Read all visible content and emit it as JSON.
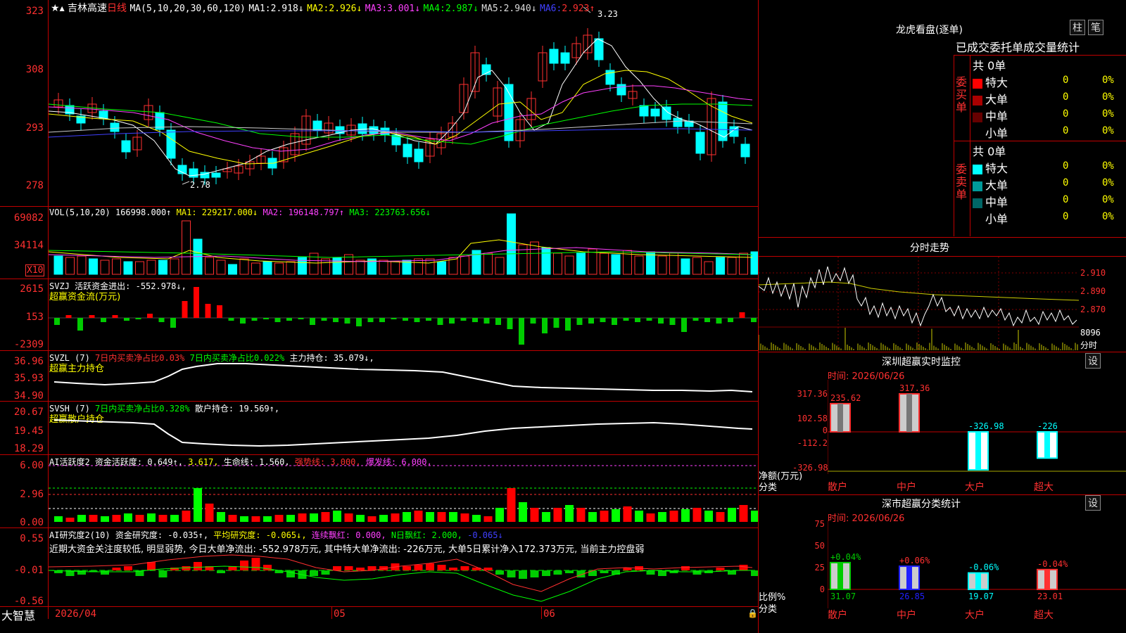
{
  "main": {
    "stock_name": "吉林高速",
    "period": "日线",
    "ma_title": "MA(5,10,20,30,60,120)",
    "ma": [
      {
        "label": "MA1:",
        "value": "2.918↓",
        "color": "#ffffff"
      },
      {
        "label": "MA2:",
        "value": "2.926↓",
        "color": "#ffff00"
      },
      {
        "label": "MA3:",
        "value": "3.001↓",
        "color": "#ff40ff"
      },
      {
        "label": "MA4:",
        "value": "2.987↓",
        "color": "#00ff00"
      },
      {
        "label": "MA5:",
        "value": "2.940↓",
        "color": "#dddddd"
      },
      {
        "label": "MA6:",
        "value": "2.923↑",
        "color": "#4040ff"
      }
    ],
    "yaxis": [
      "323",
      "308",
      "293",
      "278"
    ],
    "high_label": "3.23",
    "low_label": "2.78"
  },
  "vol": {
    "title": "VOL(5,10,20)",
    "value": "166998.000↑",
    "ma1": "MA1: 229217.000↓",
    "ma2": "MA2: 196148.797↑",
    "ma3": "MA3: 223763.656↓",
    "yaxis": [
      "69082",
      "34114"
    ],
    "unit": "X10"
  },
  "svzj": {
    "title": "SVZJ",
    "text": "活跃资金进出: -552.978↓,",
    "sub": "超赢资金流(万元)",
    "yaxis": [
      "2615",
      "153",
      "-2309"
    ]
  },
  "svzl": {
    "title": "SVZL (7)",
    "t1": "7日内买卖净占比0.03%",
    "t2": "7日内买卖净占比0.022%",
    "t3": "主力持仓: 35.079↓,",
    "sub": "超赢主力持仓",
    "yaxis": [
      "36.96",
      "35.93",
      "34.90"
    ]
  },
  "svsh": {
    "title": "SVSH (7)",
    "t1": "7日内买卖净占比0.328%",
    "t2": "散户持仓: 19.569↑,",
    "sub": "超赢散户持仓",
    "yaxis": [
      "20.67",
      "19.45",
      "18.29"
    ]
  },
  "ai1": {
    "title": "AI活跃度2",
    "t1": "资金活跃度: 0.649↑,",
    "t2": "3.617,",
    "t3": "生命线: 1.560,",
    "t4": "强势线: 3.000,",
    "t5": "爆发线: 6.000,",
    "yaxis": [
      "6.00",
      "2.96",
      "0.00"
    ]
  },
  "ai2": {
    "title": "AI研究度2(10)",
    "t1": "资金研究度: -0.035↑,",
    "t2": "平均研究度: -0.065↓,",
    "t3": "连续飘红: 0.000,",
    "t4": "N日飘红: 2.000,",
    "t5": "-0.065↓",
    "comment": "近期大资金关注度较低, 明显弱势, 今日大单净流出: -552.978万元, 其中特大单净流出: -226万元, 大单5日累计净入172.373万元, 当前主力控盘弱",
    "yaxis": [
      "0.55",
      "-0.01",
      "-0.56"
    ]
  },
  "bottom": {
    "logo": "大智慧",
    "dates": [
      "2026/04",
      "05",
      "06"
    ]
  },
  "right": {
    "dragon_title": "龙虎看盘(逐单)",
    "btn_zhu": "柱",
    "btn_bi": "笔",
    "stat_title": "已成交委托单成交量统计",
    "buy_label": "委买单",
    "sell_label": "委卖单",
    "buy_total": "共 0单",
    "sell_total": "共 0单",
    "rows": [
      {
        "name": "特大",
        "v": "0",
        "p": "0%"
      },
      {
        "name": "大单",
        "v": "0",
        "p": "0%"
      },
      {
        "name": "中单",
        "v": "0",
        "p": "0%"
      },
      {
        "name": "小单",
        "v": "0",
        "p": "0%"
      }
    ],
    "intraday_title": "分时走势",
    "intraday_y": [
      "2.910",
      "2.890",
      "2.870"
    ],
    "intraday_vol": "8096",
    "intraday_unit": "分时",
    "sz_title": "深圳超赢实时监控",
    "sz_btn": "设",
    "sz_time": "时间: 2026/06/26",
    "sz_y": [
      "317.36",
      "102.58",
      "0",
      "-112.2",
      "-326.98"
    ],
    "sz_bars": [
      {
        "cat": "散户",
        "value": "235.62"
      },
      {
        "cat": "中户",
        "value": "317.36"
      },
      {
        "cat": "大户",
        "value": "-326.98"
      },
      {
        "cat": "超大",
        "value": "-226"
      }
    ],
    "sz_axis_a": "净额(万元)",
    "sz_axis_b": "分类",
    "cls_title": "深市超赢分类统计",
    "cls_btn": "设",
    "cls_time": "时间: 2026/06/26",
    "cls_y": [
      "75",
      "50",
      "25",
      "0"
    ],
    "cls_bars": [
      {
        "cat": "散户",
        "value": "31.07",
        "pct": "+0.04%"
      },
      {
        "cat": "中户",
        "value": "26.85",
        "pct": "+0.06%"
      },
      {
        "cat": "大户",
        "value": "19.07",
        "pct": "-0.06%"
      },
      {
        "cat": "超大",
        "value": "23.01",
        "pct": "-0.04%"
      }
    ],
    "cls_axis_a": "比例%",
    "cls_axis_b": "分类"
  },
  "chart_data": [
    {
      "type": "bar",
      "title": "深圳超赢实时监控",
      "categories": [
        "散户",
        "中户",
        "大户",
        "超大"
      ],
      "values": [
        235.62,
        317.36,
        -326.98,
        -226
      ],
      "ylabel": "净额(万元)",
      "xlabel": "分类",
      "ylim": [
        -326.98,
        317.36
      ]
    },
    {
      "type": "bar",
      "title": "深市超赢分类统计",
      "categories": [
        "散户",
        "中户",
        "大户",
        "超大"
      ],
      "values": [
        31.07,
        26.85,
        19.07,
        23.01
      ],
      "ylabel": "比例%",
      "xlabel": "分类",
      "ylim": [
        0,
        75
      ]
    }
  ]
}
